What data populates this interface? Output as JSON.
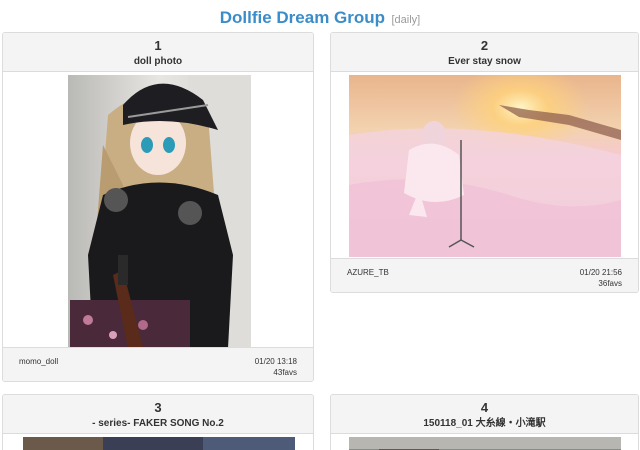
{
  "header": {
    "title": "Dollfie Dream Group",
    "tag": "[daily]"
  },
  "photos": [
    {
      "rank": "1",
      "title": "doll photo",
      "user": "momo_doll",
      "date": "01/20 13:18",
      "favs": "43favs"
    },
    {
      "rank": "2",
      "title": "Ever stay snow",
      "user": "AZURE_TB",
      "date": "01/20 21:56",
      "favs": "36favs"
    },
    {
      "rank": "3",
      "title": "- series- FAKER SONG No.2"
    },
    {
      "rank": "4",
      "title": "150118_01 大糸線・小滝駅"
    }
  ]
}
